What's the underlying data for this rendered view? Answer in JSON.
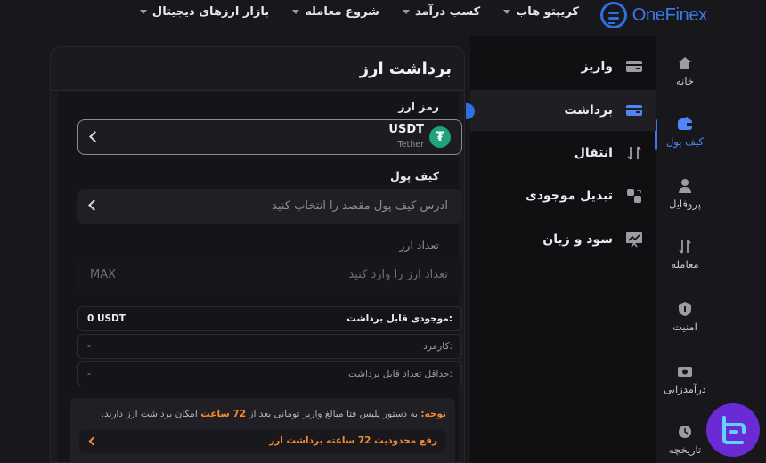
{
  "brand": {
    "name": "OneFinex",
    "accent": "#3a7bea"
  },
  "topnav": [
    {
      "label": "بازار ارزهای دیجیتال",
      "icon": "caret-down-icon"
    },
    {
      "label": "شروع معامله",
      "icon": "caret-down-icon"
    },
    {
      "label": "کسب درآمد",
      "icon": "caret-down-icon"
    },
    {
      "label": "کریپتو هاب",
      "icon": "caret-down-icon"
    }
  ],
  "rail": [
    {
      "label": "خانه",
      "icon": "home-icon"
    },
    {
      "label": "کیف پول",
      "icon": "wallet-icon",
      "active": true
    },
    {
      "label": "پروفایل",
      "icon": "user-icon"
    },
    {
      "label": "معامله",
      "icon": "trade-arrows-icon"
    },
    {
      "label": "امنیت",
      "icon": "shield-icon"
    },
    {
      "label": "درآمدزایی",
      "icon": "earn-icon"
    },
    {
      "label": "تاریخچه",
      "icon": "clock-icon"
    }
  ],
  "submenu": [
    {
      "label": "واریز",
      "icon": "deposit-card-icon"
    },
    {
      "label": "برداشت",
      "icon": "withdraw-card-icon",
      "active": true
    },
    {
      "label": "انتقال",
      "icon": "transfer-arrows-icon"
    },
    {
      "label": "تبدیل موجودی",
      "icon": "convert-icon"
    },
    {
      "label": "سود و زیان",
      "icon": "pnl-chart-icon"
    }
  ],
  "withdraw": {
    "title": "برداشت ارز",
    "coin_label": "رمز ارز",
    "coin_name": "USDT",
    "coin_sub": "Tether",
    "coin_symbol": "₮",
    "wallet_label": "کیف پول",
    "wallet_placeholder": "آدرس کیف پول مقصد را انتخاب کنید",
    "amount_label": "تعداد ارز",
    "amount_placeholder": "تعداد ارز را وارد کنید",
    "max_label": "MAX",
    "available_label": "موجودی قابل برداشت:",
    "available_value": "0 USDT",
    "fee_label": "کارمزد:",
    "fee_value": "-",
    "min_label": "حداقل تعداد قابل برداشت:",
    "min_value": "-",
    "note_prefix": "توجه:",
    "note_part1": " به دستور پلیس فتا مبالغ واریز تومانی بعد از ",
    "note_highlight": "72 ساعت",
    "note_part2": " امکان برداشت ارز دارند.",
    "note_button": "رفع محدودیت 72 ساعته برداشت ارز"
  },
  "colors": {
    "warning": "#f28b2e",
    "tether": "#1ea37a",
    "active": "#4f86f7"
  }
}
